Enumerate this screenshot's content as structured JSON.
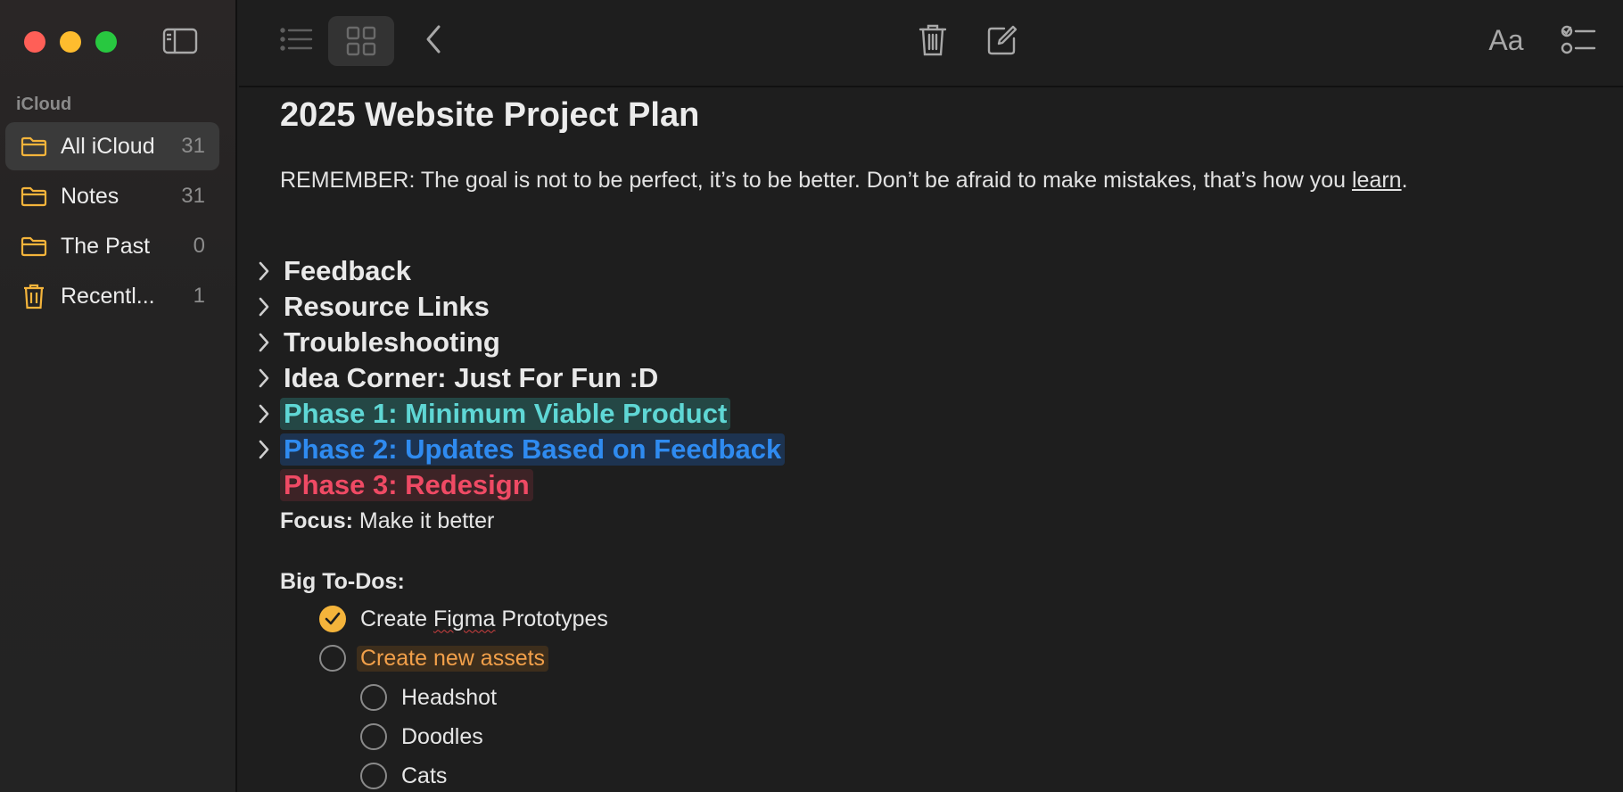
{
  "sidebar": {
    "section_label": "iCloud",
    "folders": [
      {
        "name": "All iCloud",
        "count": "31",
        "icon": "folder-icon",
        "selected": true
      },
      {
        "name": "Notes",
        "count": "31",
        "icon": "folder-icon",
        "selected": false
      },
      {
        "name": "The Past",
        "count": "0",
        "icon": "folder-icon",
        "selected": false
      },
      {
        "name": "Recentl...",
        "count": "1",
        "icon": "trash-icon",
        "selected": false
      }
    ],
    "accent_color": "#f4b43b"
  },
  "toolbar": {
    "font_button_label": "Aa",
    "icons": [
      "list-view-icon",
      "gallery-view-icon",
      "back-chevron-icon",
      "trash-icon",
      "compose-icon",
      "checklist-icon"
    ]
  },
  "note": {
    "title": "2025 Website Project Plan",
    "remember_text": "REMEMBER: The goal is not to be perfect, it’s to be better. Don’t be afraid to make mistakes, that’s how you ",
    "remember_link": "learn",
    "remember_end": ".",
    "headings": [
      {
        "text": "Feedback",
        "collapsed": true,
        "style": "plain"
      },
      {
        "text": "Resource Links",
        "collapsed": true,
        "style": "plain"
      },
      {
        "text": "Troubleshooting",
        "collapsed": true,
        "style": "plain"
      },
      {
        "text": "Idea Corner: Just For Fun :D",
        "collapsed": true,
        "style": "plain"
      },
      {
        "text": "Phase 1: Minimum Viable Product",
        "collapsed": true,
        "style": "teal"
      },
      {
        "text": "Phase 2: Updates Based on Feedback",
        "collapsed": true,
        "style": "blue"
      },
      {
        "text": "Phase 3: Redesign",
        "collapsed": false,
        "style": "red"
      }
    ],
    "focus_label": "Focus:",
    "focus_text": " Make it better",
    "todos_label": "Big To-Dos:",
    "todos": [
      {
        "pre": "Create ",
        "misspelled": "Figma",
        "post": " Prototypes",
        "checked": true
      },
      {
        "text": "Create new assets",
        "checked": false,
        "highlight": "orange"
      },
      {
        "text": "Headshot",
        "checked": false
      },
      {
        "text": "Doodles",
        "checked": false
      },
      {
        "text": "Cats",
        "checked": false
      }
    ]
  },
  "colors": {
    "teal": "#5fd7d5",
    "blue": "#2f8bf0",
    "red": "#ef4a64",
    "orange": "#f2a04a"
  }
}
